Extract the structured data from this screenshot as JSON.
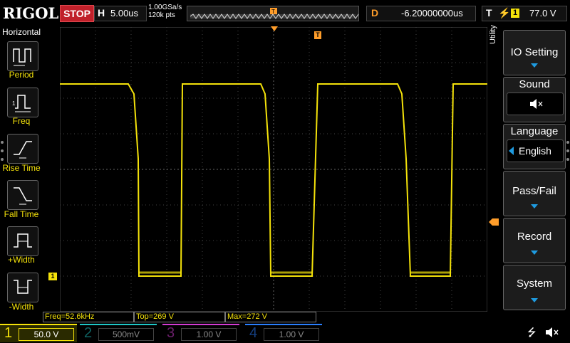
{
  "top": {
    "brand": "RIGOL",
    "run_state": "STOP",
    "horizontal_key": "H",
    "timebase": "5.00us",
    "sample_rate": "1.00GSa/s",
    "memory_depth": "120k pts",
    "delay_key": "D",
    "delay_value": "-6.20000000us",
    "trigger_key": "T",
    "trigger_channel": "1",
    "trigger_level": "77.0 V"
  },
  "left_panel": {
    "title": "Horizontal",
    "items": [
      {
        "label": "Period",
        "icon": "period-icon"
      },
      {
        "label": "Freq",
        "icon": "freq-icon"
      },
      {
        "label": "Rise Time",
        "icon": "rise-time-icon"
      },
      {
        "label": "Fall Time",
        "icon": "fall-time-icon"
      },
      {
        "label": "+Width",
        "icon": "positive-width-icon"
      },
      {
        "label": "-Width",
        "icon": "negative-width-icon"
      }
    ]
  },
  "right_panel": {
    "title": "Utility",
    "items": [
      {
        "label": "IO Setting"
      },
      {
        "label": "Sound",
        "value_icon": "speaker-muted-icon"
      },
      {
        "label": "Language",
        "value": "English"
      },
      {
        "label": "Pass/Fail"
      },
      {
        "label": "Record"
      },
      {
        "label": "System"
      }
    ]
  },
  "measurements": {
    "freq": "Freq=52.6kHz",
    "top": "Top=269 V",
    "max": "Max=272 V"
  },
  "channels": [
    {
      "num": "1",
      "value": "50.0 V",
      "color": "#f4e20a",
      "active": true
    },
    {
      "num": "2",
      "value": "500mV",
      "color": "#1fc8c8",
      "active": false
    },
    {
      "num": "3",
      "value": "1.00 V",
      "color": "#d43cd4",
      "active": false
    },
    {
      "num": "4",
      "value": "1.00 V",
      "color": "#2a7fff",
      "active": false
    }
  ],
  "marker": {
    "ch1": "1"
  },
  "colors": {
    "ch1": "#f4e20a",
    "accent": "#1e9be0",
    "delay": "#ff9d2a",
    "stop": "#c0202a"
  }
}
